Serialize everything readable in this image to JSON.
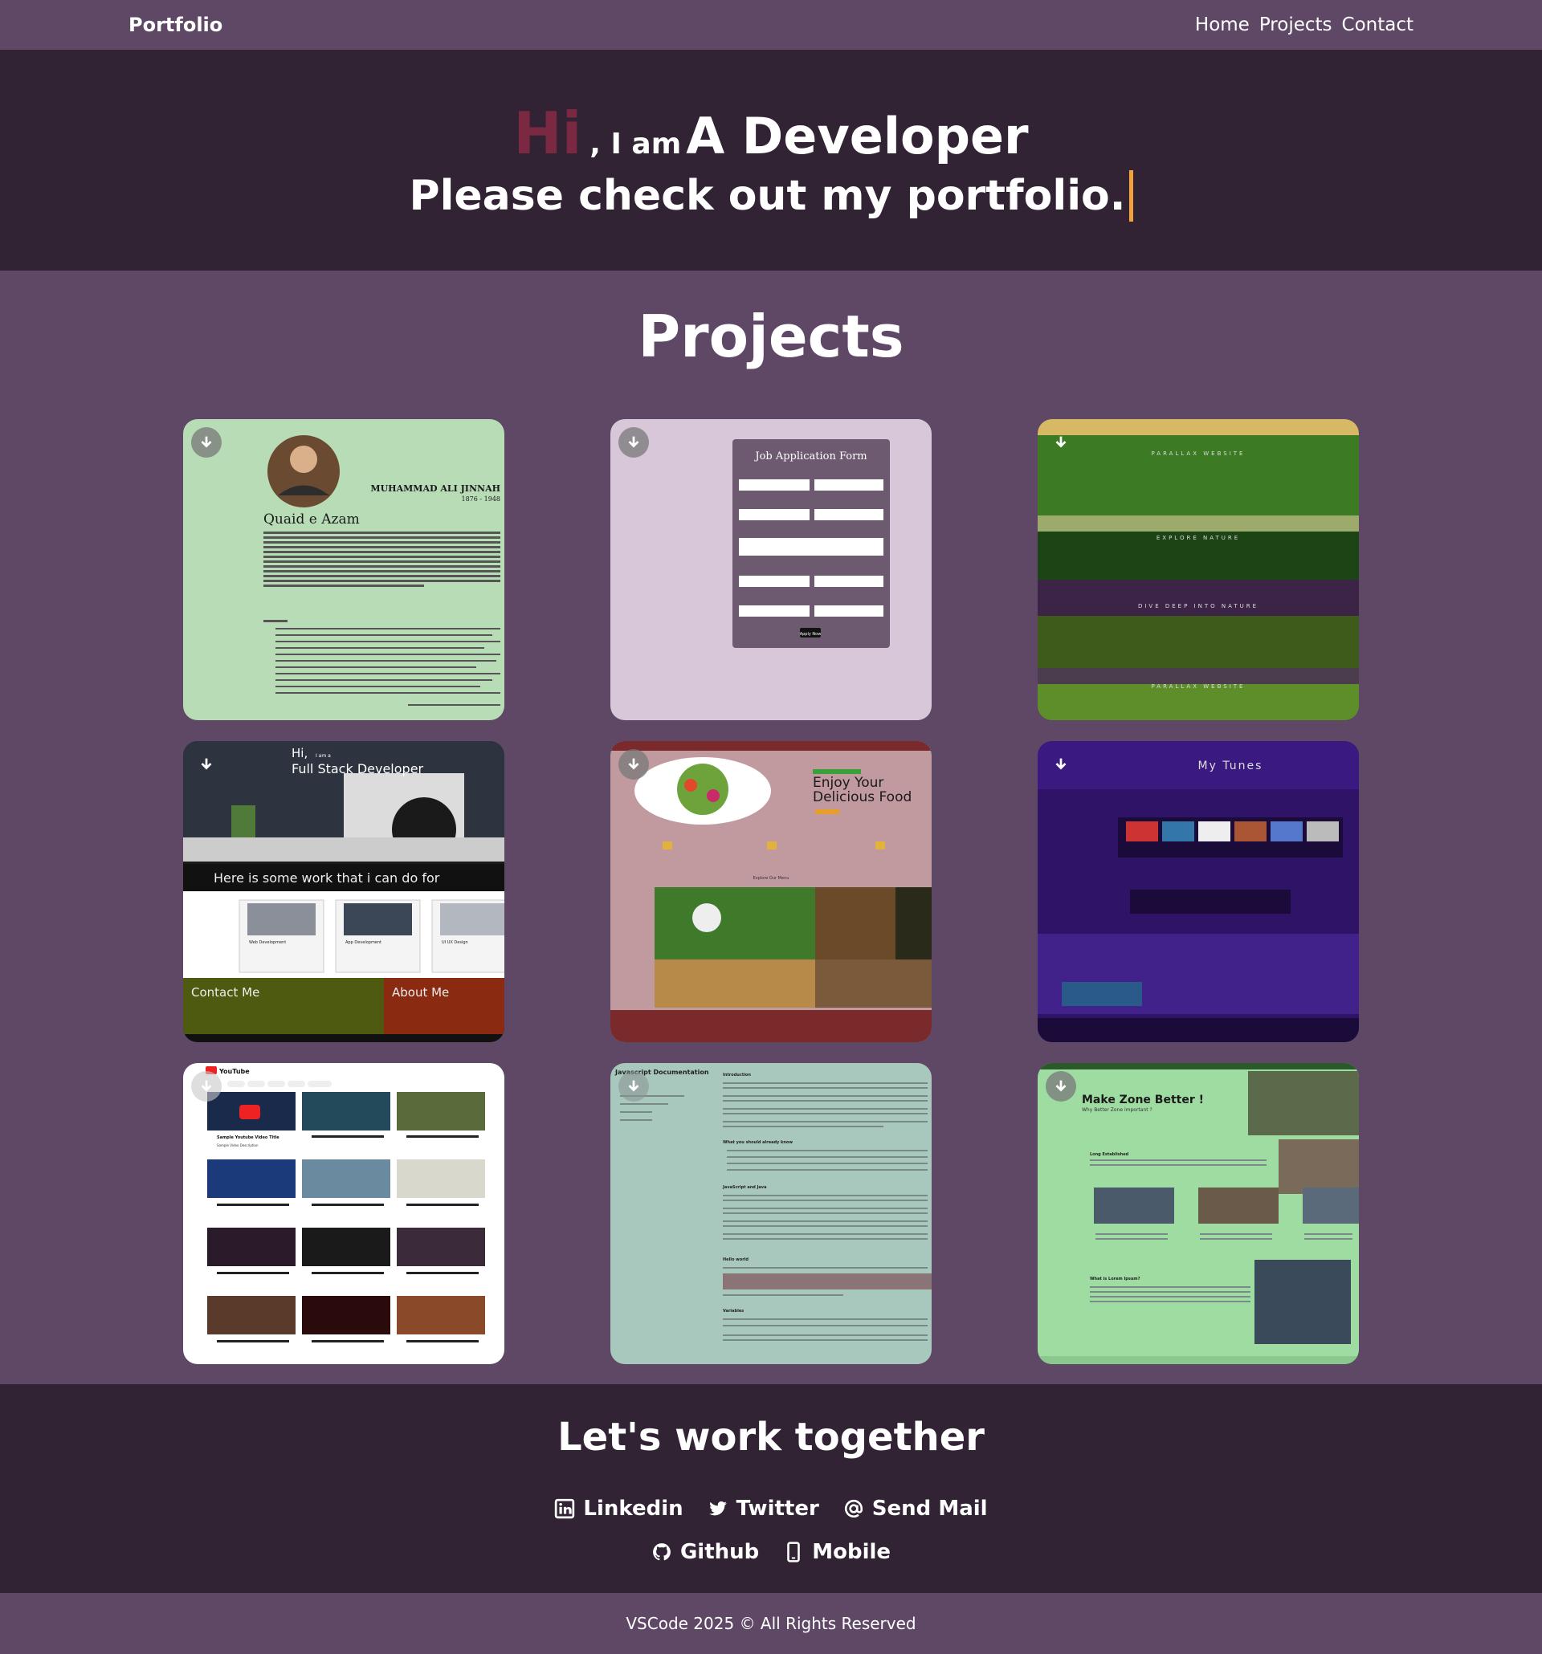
{
  "navbar": {
    "brand": "Portfolio",
    "links": [
      "Home",
      "Projects",
      "Contact"
    ]
  },
  "hero": {
    "hi": "Hi",
    "iam": ", I am",
    "role": "A Developer",
    "tagline": "Please check out my portfolio."
  },
  "projects": {
    "title": "Projects",
    "cards": [
      {
        "name": "jinnah-tribute",
        "bg": "#b7dcb6",
        "texts": [
          "MUHAMMAD ALI JINNAH",
          "1876 - 1948",
          "Quaid e Azam"
        ]
      },
      {
        "name": "job-application-form",
        "bg": "#d7c7d9",
        "texts": [
          "Job Application Form",
          "Apply Now"
        ]
      },
      {
        "name": "parallax-website",
        "bg": "#5a7d35",
        "texts": [
          "PARALLAX WEBSITE",
          "EXPLORE NATURE",
          "DIVE DEEP INTO NATURE",
          "PARALLAX WEBSITE"
        ]
      },
      {
        "name": "full-stack-portfolio",
        "bg": "#1b1b1b",
        "texts": [
          "Hi,",
          "I am a",
          "Full Stack Developer",
          "Here is some work that i can do for",
          "Web Development",
          "App Development",
          "UI UX Design",
          "Contact Me",
          "About Me"
        ]
      },
      {
        "name": "food-website",
        "bg": "#c19aa0",
        "texts": [
          "Enjoy Your",
          "Delicious Food",
          "Explore Our Menu"
        ]
      },
      {
        "name": "my-tunes",
        "bg": "#2e1366",
        "texts": [
          "My Tunes"
        ]
      },
      {
        "name": "youtube-clone",
        "bg": "#ffffff",
        "texts": [
          "YouTube",
          "Sample Youtube Video Title",
          "Sample Video Description"
        ]
      },
      {
        "name": "javascript-documentation",
        "bg": "#a8c8bd",
        "texts": [
          "Javascript Documentation",
          "Introduction",
          "What you should already know",
          "JavaScript and Java",
          "Hello world",
          "Variables"
        ]
      },
      {
        "name": "great-zone",
        "bg": "#9fdca2",
        "texts": [
          "Make Zone Better !",
          "Why Better Zone important ?",
          "Long Established",
          "What is Lorem Ipsum?"
        ]
      }
    ]
  },
  "contact": {
    "title": "Let's work together",
    "links": [
      {
        "label": "Linkedin",
        "icon": "linkedin-icon"
      },
      {
        "label": "Twitter",
        "icon": "twitter-icon"
      },
      {
        "label": "Send Mail",
        "icon": "at-icon"
      },
      {
        "label": "Github",
        "icon": "github-icon"
      },
      {
        "label": "Mobile",
        "icon": "mobile-icon"
      }
    ]
  },
  "footer": {
    "text": "VSCode 2025 © All Rights Reserved"
  },
  "colors": {
    "nav_bg": "#5f4866",
    "dark_bg": "#312234",
    "hi": "#7b2942",
    "cursor": "#f2a23c"
  }
}
